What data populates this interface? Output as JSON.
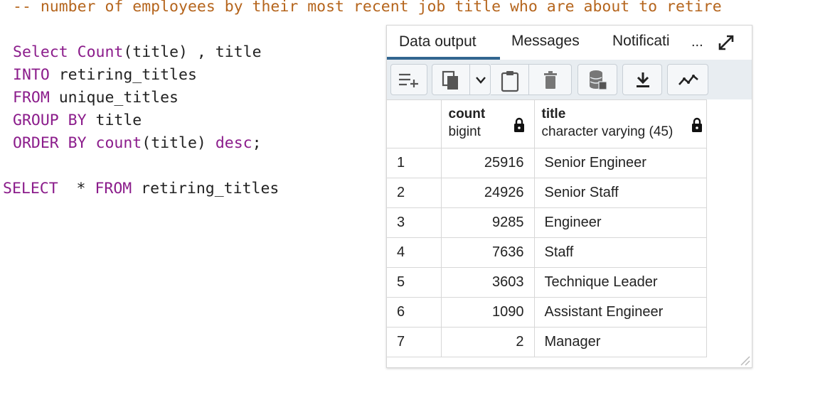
{
  "editor": {
    "comment": "-- number of employees by their most recent job title who are about to retire",
    "line1": {
      "kw1": "Select",
      "fn": "Count",
      "rest": "(title) , title"
    },
    "line2": {
      "kw": "INTO",
      "rest": " retiring_titles"
    },
    "line3": {
      "kw": "FROM",
      "rest": " unique_titles"
    },
    "line4": {
      "kw": "GROUP BY",
      "rest": " title"
    },
    "line5": {
      "kw": "ORDER BY",
      "fn": "count",
      "mid": "(title) ",
      "kw2": "desc",
      "end": ";"
    },
    "line6": {
      "kw": "SELECT",
      "mid": "  * ",
      "kw2": "FROM",
      "rest": " retiring_titles"
    }
  },
  "panel": {
    "tabs": [
      "Data output",
      "Messages",
      "Notificati"
    ],
    "more": "...",
    "columns": [
      {
        "name": "count",
        "type": "bigint"
      },
      {
        "name": "title",
        "type": "character varying (45)"
      }
    ],
    "rows": [
      {
        "n": "1",
        "count": "25916",
        "title": "Senior Engineer"
      },
      {
        "n": "2",
        "count": "24926",
        "title": "Senior Staff"
      },
      {
        "n": "3",
        "count": "9285",
        "title": "Engineer"
      },
      {
        "n": "4",
        "count": "7636",
        "title": "Staff"
      },
      {
        "n": "5",
        "count": "3603",
        "title": "Technique Leader"
      },
      {
        "n": "6",
        "count": "1090",
        "title": "Assistant Engineer"
      },
      {
        "n": "7",
        "count": "2",
        "title": "Manager"
      }
    ]
  },
  "colors": {
    "keyword": "#8b1c8b",
    "comment": "#b5651d",
    "active_tab": "#326690"
  }
}
